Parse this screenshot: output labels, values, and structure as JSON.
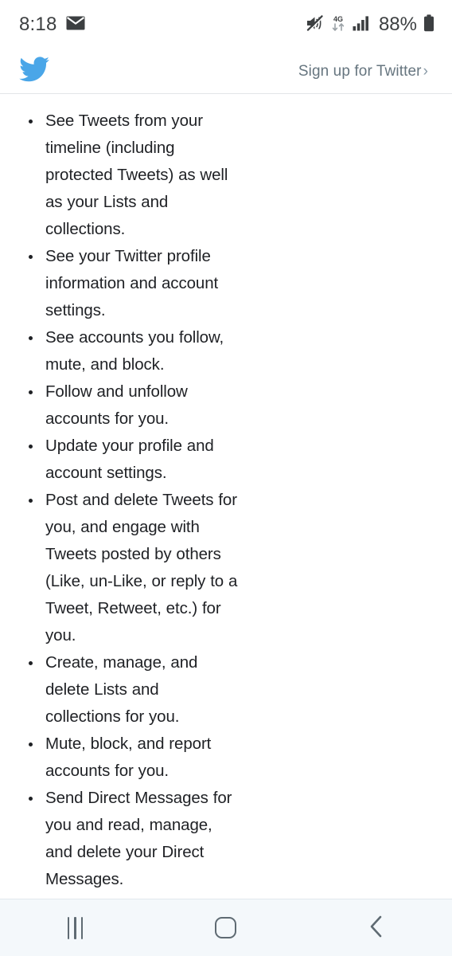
{
  "status_bar": {
    "time": "8:18",
    "mail_icon": "envelope-icon",
    "mute_icon": "mute-speaker-icon",
    "network_icon": "4g-data-transfer-icon",
    "network_label": "4G",
    "signal_icon": "signal-bars-icon",
    "battery_percent": "88%",
    "battery_icon": "battery-icon"
  },
  "header": {
    "logo": "twitter-bird-logo",
    "signup_label": "Sign up for Twitter",
    "signup_chevron": "›",
    "accent_color": "#4aa6e8",
    "link_color": "#66757f"
  },
  "permissions": {
    "items": [
      "See Tweets from your timeline (including protected Tweets) as well as your Lists and collections.",
      "See your Twitter profile information and account settings.",
      "See accounts you follow, mute, and block.",
      "Follow and unfollow accounts for you.",
      "Update your profile and account settings.",
      "Post and delete Tweets for you, and engage with Tweets posted by others (Like, un-Like, or reply to a Tweet, Retweet, etc.) for you.",
      "Create, manage, and delete Lists and collections for you.",
      "Mute, block, and report accounts for you.",
      "Send Direct Messages for you and read, manage, and delete your Direct Messages."
    ]
  },
  "nav_bar": {
    "recents_label": "Recents",
    "home_label": "Home",
    "back_label": "Back",
    "background_color": "#f4f8fb",
    "icon_color": "#5f6b73"
  }
}
